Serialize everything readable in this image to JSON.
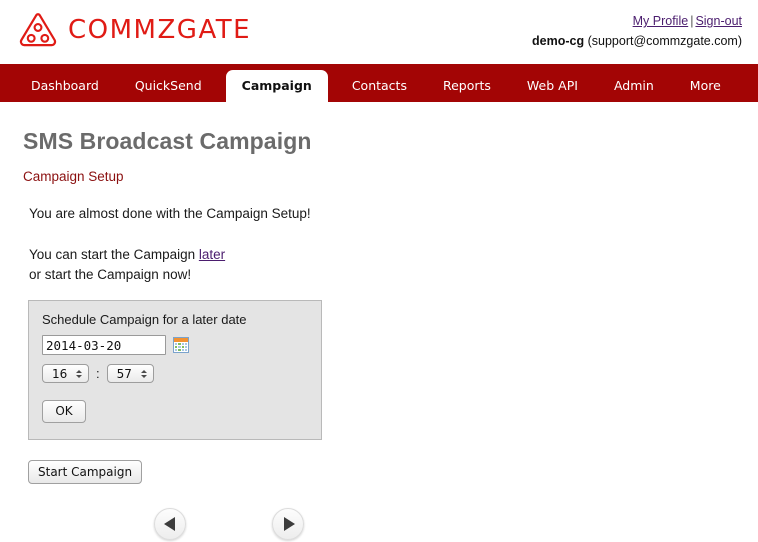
{
  "brand": {
    "name": "COMMZGATE",
    "logo_icon": "triangle-dots-logo-icon",
    "logo_color": "#e01b15"
  },
  "account": {
    "profile_link": "My Profile",
    "separator": "|",
    "signout_link": "Sign-out",
    "username": "demo-cg",
    "email": "(support@commzgate.com)"
  },
  "nav": {
    "bar_color": "#a30505",
    "items": [
      {
        "label": "Dashboard",
        "active": false
      },
      {
        "label": "QuickSend",
        "active": false
      },
      {
        "label": "Campaign",
        "active": true
      },
      {
        "label": "Contacts",
        "active": false
      },
      {
        "label": "Reports",
        "active": false
      },
      {
        "label": "Web API",
        "active": false
      },
      {
        "label": "Admin",
        "active": false
      },
      {
        "label": "More",
        "active": false
      }
    ]
  },
  "main": {
    "page_title": "SMS Broadcast Campaign",
    "section_label": "Campaign Setup",
    "section_label_color": "#8b1010",
    "lead_text": "You are almost done with the Campaign Setup!",
    "choice_prefix": "You can start the Campaign ",
    "choice_link": "later",
    "choice_line2": "or start the Campaign now!"
  },
  "schedule": {
    "title": "Schedule Campaign for a later date",
    "date_value": "2014-03-20",
    "date_placeholder": "YYYY-MM-DD",
    "calendar_icon": "calendar-picker-icon",
    "hour_value": "16",
    "time_separator": ":",
    "minute_value": "57",
    "ok_label": "OK"
  },
  "actions": {
    "start_campaign_label": "Start Campaign"
  },
  "pager": {
    "prev_icon": "triangle-left-icon",
    "next_icon": "triangle-right-icon"
  }
}
